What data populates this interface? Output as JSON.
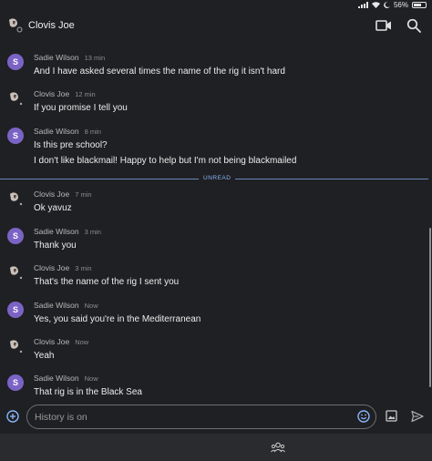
{
  "status_bar": {
    "battery": "56%"
  },
  "header": {
    "title": "Clovis Joe",
    "avatar": "profile-photo",
    "video_icon": "video-camera-icon",
    "search_icon": "search-icon"
  },
  "messages": [
    {
      "sender": "Sadie Wilson",
      "time": "13 min",
      "avatar_letter": "S",
      "lines": [
        "And I have asked several times the name of the rig it isn't hard"
      ]
    },
    {
      "sender": "Clovis Joe",
      "time": "12 min",
      "avatar_letter": "",
      "lines": [
        "If you promise I tell you"
      ]
    },
    {
      "sender": "Sadie Wilson",
      "time": "8 min",
      "avatar_letter": "S",
      "lines": [
        "Is this pre school?",
        "I don't like blackmail! Happy to help but I'm not being blackmailed"
      ]
    },
    {
      "sender": "Clovis Joe",
      "time": "7 min",
      "avatar_letter": "",
      "lines": [
        "Ok yavuz"
      ]
    },
    {
      "sender": "Sadie Wilson",
      "time": "3 min",
      "avatar_letter": "S",
      "lines": [
        "Thank you"
      ]
    },
    {
      "sender": "Clovis Joe",
      "time": "3 min",
      "avatar_letter": "",
      "lines": [
        "That's the name of the rig I sent you"
      ]
    },
    {
      "sender": "Sadie Wilson",
      "time": "Now",
      "avatar_letter": "S",
      "lines": [
        "Yes, you said you're in the Mediterranean"
      ]
    },
    {
      "sender": "Clovis Joe",
      "time": "Now",
      "avatar_letter": "",
      "lines": [
        "Yeah"
      ]
    },
    {
      "sender": "Sadie Wilson",
      "time": "Now",
      "avatar_letter": "S",
      "lines": [
        "That rig is in the Black Sea"
      ]
    }
  ],
  "divider_label": "UNREAD",
  "compose": {
    "placeholder": "History is on",
    "add_icon": "add-circle-icon",
    "emoji_icon": "emoji-icon",
    "image_icon": "image-icon",
    "send_icon": "send-icon"
  },
  "bottom_bar": {
    "members_icon": "members-icon"
  },
  "colors": {
    "background": "#1f2023",
    "accent": "#8ab4f8",
    "avatar_purple": "#7b63c6"
  }
}
